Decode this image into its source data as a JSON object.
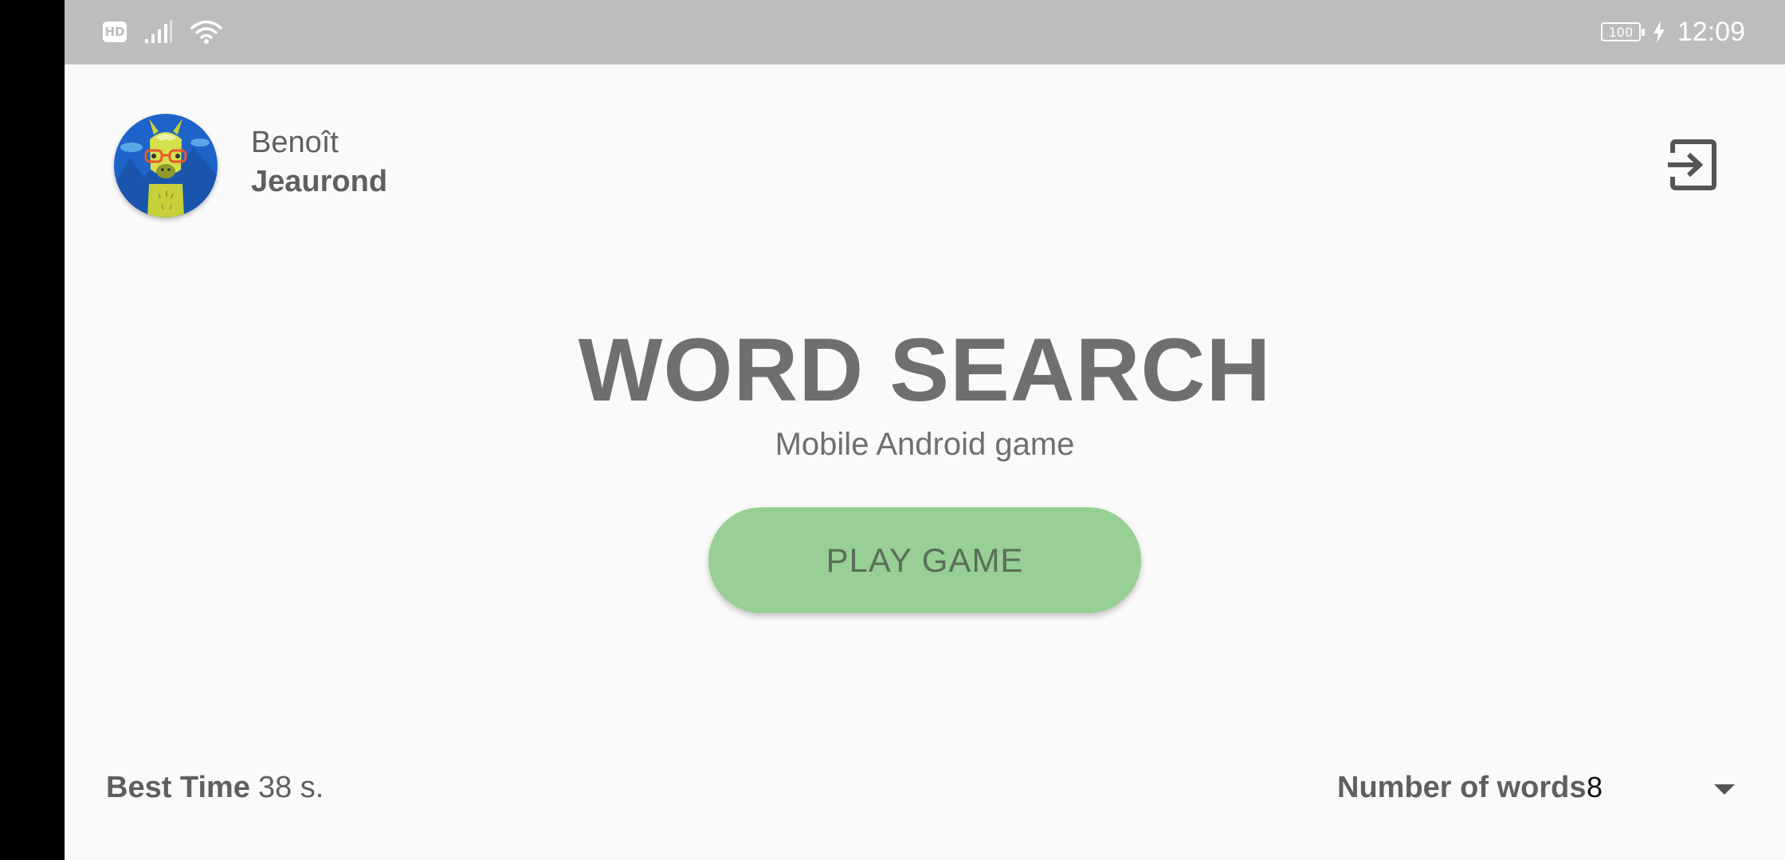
{
  "status_bar": {
    "hd_label": "HD",
    "battery_level": "100",
    "time": "12:09"
  },
  "profile": {
    "first_name": "Benoît",
    "last_name": "Jeaurond",
    "avatar_icon": "llama-with-glasses-avatar"
  },
  "header": {
    "logout_icon": "exit-to-app-icon"
  },
  "main": {
    "title": "WORD SEARCH",
    "subtitle": "Mobile Android game",
    "play_button_label": "PLAY GAME"
  },
  "footer": {
    "best_time_label": "Best Time",
    "best_time_value": "38 s.",
    "number_of_words_label": "Number of words",
    "number_of_words_value": "8"
  },
  "colors": {
    "status_bar": "#bdbdbd",
    "background": "#fafafa",
    "play_button": "#97cf94",
    "text": "#6f6f6f"
  }
}
